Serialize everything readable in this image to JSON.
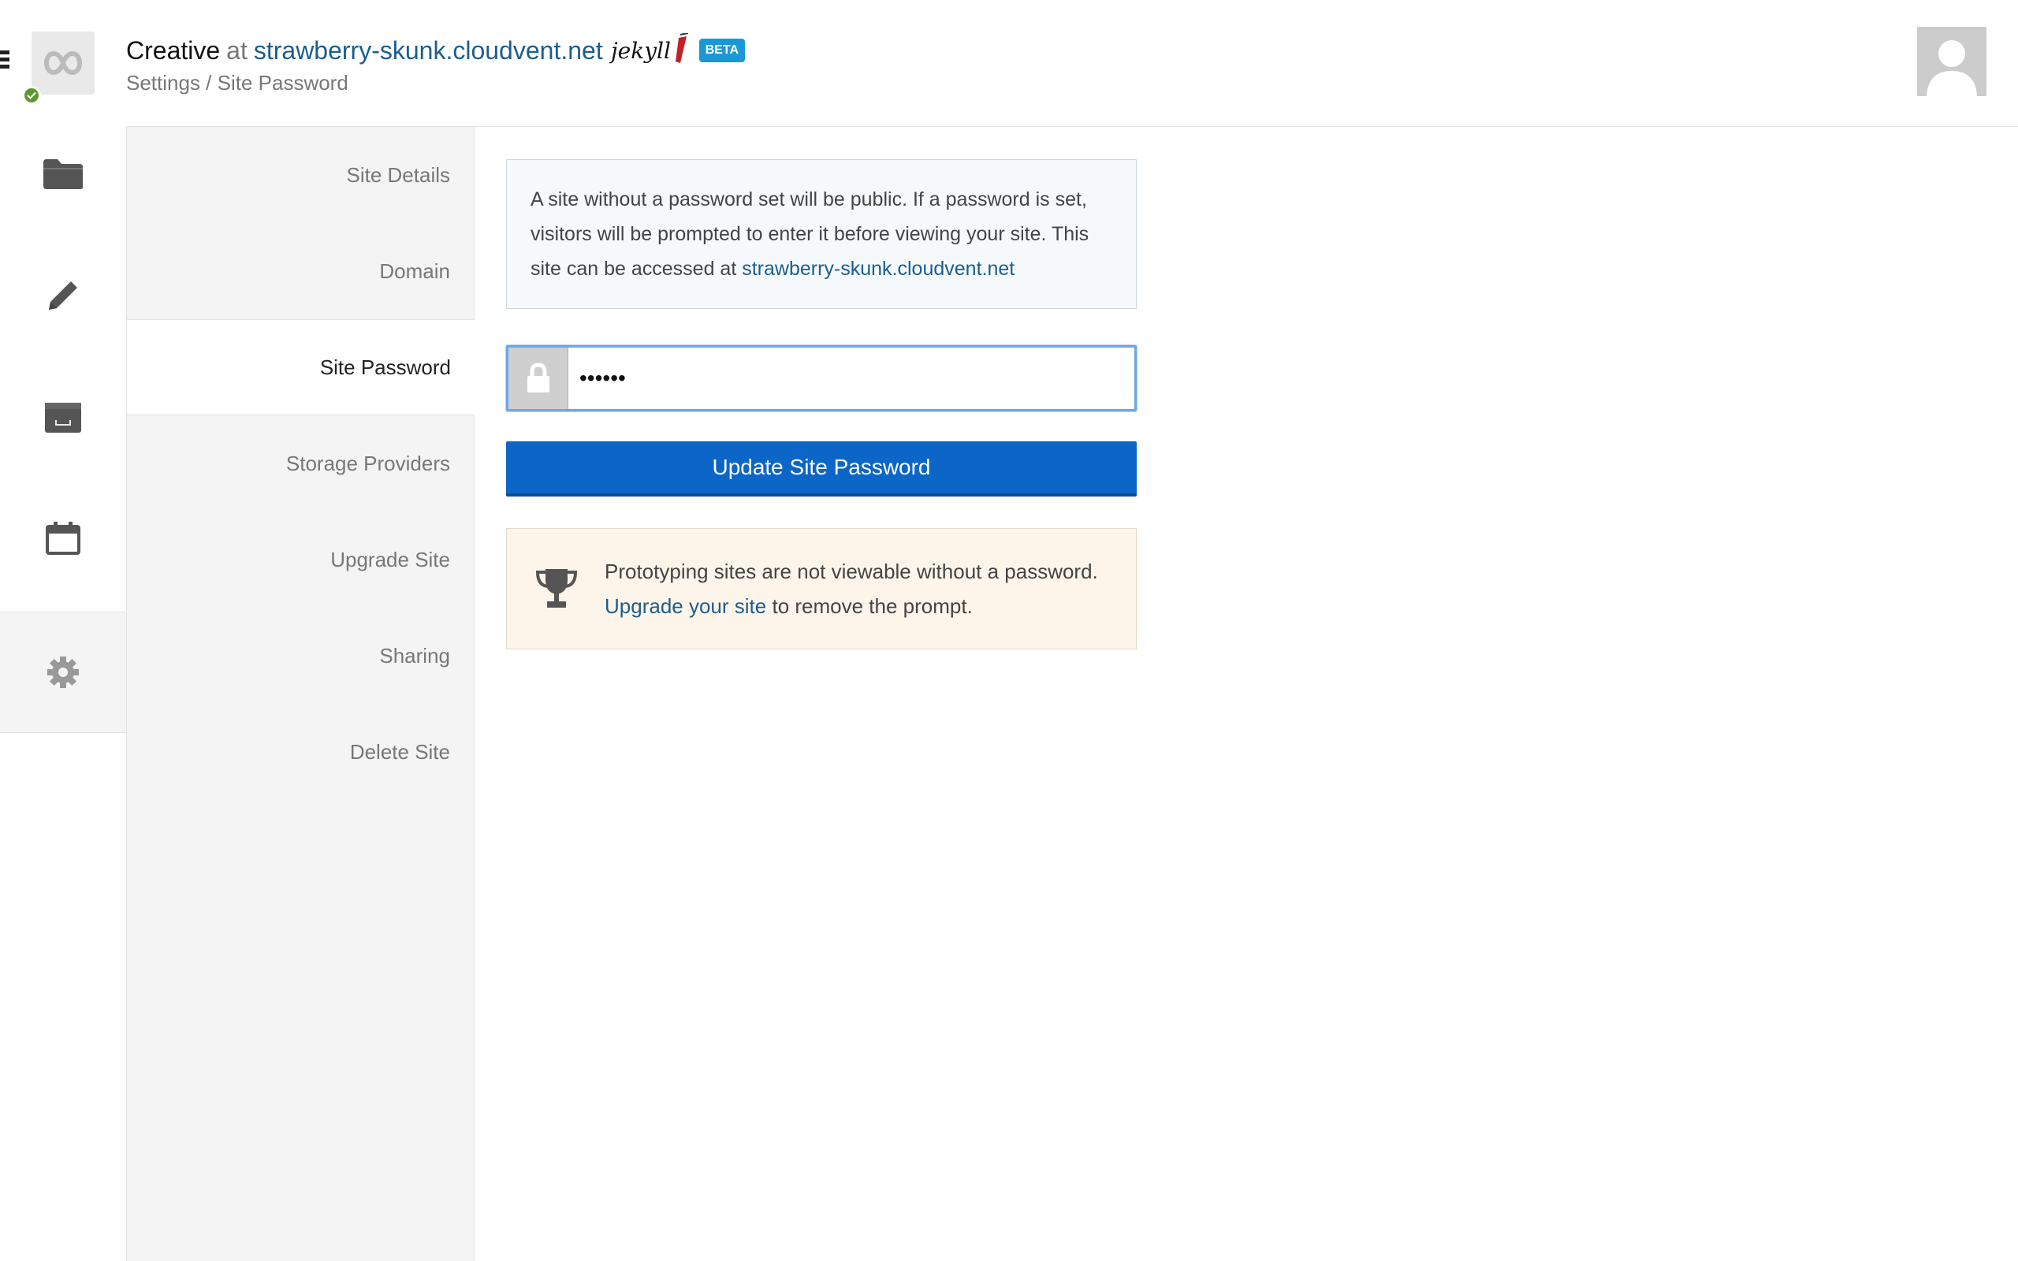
{
  "header": {
    "site_name": "Creative",
    "at": "at",
    "site_url": "strawberry-skunk.cloudvent.net",
    "generator_logo": "jekyll",
    "beta_badge": "BETA",
    "breadcrumb": "Settings / Site Password"
  },
  "rail": {
    "icons": [
      "folder-icon",
      "pencil-icon",
      "inbox-icon",
      "calendar-icon",
      "gear-icon"
    ],
    "active": "gear-icon"
  },
  "settings_nav": {
    "items": [
      {
        "label": "Site Details"
      },
      {
        "label": "Domain"
      },
      {
        "label": "Site Password"
      },
      {
        "label": "Storage Providers"
      },
      {
        "label": "Upgrade Site"
      },
      {
        "label": "Sharing"
      },
      {
        "label": "Delete Site"
      }
    ],
    "active": "Site Password"
  },
  "main": {
    "info_text": "A site without a password set will be public. If a password is set, visitors will be prompted to enter it before viewing your site. This site can be accessed at",
    "info_link": "strawberry-skunk.cloudvent.net",
    "password_value": "••••••",
    "update_button": "Update Site Password",
    "upgrade_notice_line1": "Prototyping sites are not viewable without a password.",
    "upgrade_link": "Upgrade your site",
    "upgrade_notice_tail": "to remove the prompt."
  },
  "colors": {
    "link": "#1d5d8c",
    "primary_button": "#0b66c8",
    "beta_badge": "#1a98d5",
    "status_ok": "#5a9a2a"
  }
}
